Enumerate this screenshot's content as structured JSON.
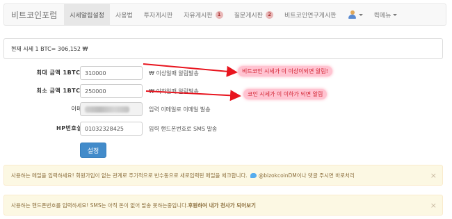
{
  "nav": {
    "brand": "비트코인포럼",
    "items": [
      {
        "label": "시세알림설정",
        "active": true
      },
      {
        "label": "사용법"
      },
      {
        "label": "투자게시판"
      },
      {
        "label": "자유게시판",
        "badge": "1"
      },
      {
        "label": "질문게시판",
        "badge": "2"
      },
      {
        "label": "비트코인연구게시판"
      }
    ],
    "quick_menu": "퀵메뉴"
  },
  "price": {
    "text": "현재 시세 1 BTC= 306,152 ₩"
  },
  "form": {
    "max": {
      "label": "최대 금액 1BTC =",
      "value": "310000",
      "help": "₩ 이상일때 알림발송"
    },
    "min": {
      "label": "최소 금액 1BTC =",
      "value": "250000",
      "help": "₩ 이하일때 알림발송"
    },
    "email": {
      "label": "이메일",
      "help": "입력 이메일로 이메일 발송"
    },
    "phone": {
      "label": "HP번호설정",
      "value": "01032328425",
      "help": "입력 핸드폰번호로 SMS 발송"
    },
    "submit": "설정"
  },
  "annotations": {
    "max_note": "비트코인 시세가 이 이상이되면 알림!",
    "min_note": "코인 시세가 이 이하가 되면 알림"
  },
  "alerts": {
    "email": {
      "text_1": "사용하는 메일을 입력하세요! 회원가입이 없는 관계로 주기적으로 반수동으로 새로입력된 메일을 체크합니다.",
      "handle": "@bizokcoinDM",
      "text_2": "이나 댓글 주시면 바로처리"
    },
    "sms": {
      "text_1": "사용하는 핸드폰번호를 입력하세요! SMS는 아직 돈이 없어 발송 못하는중입니다.",
      "bold": "후원하여 내가 천사가 되어보기"
    },
    "close": "×"
  }
}
